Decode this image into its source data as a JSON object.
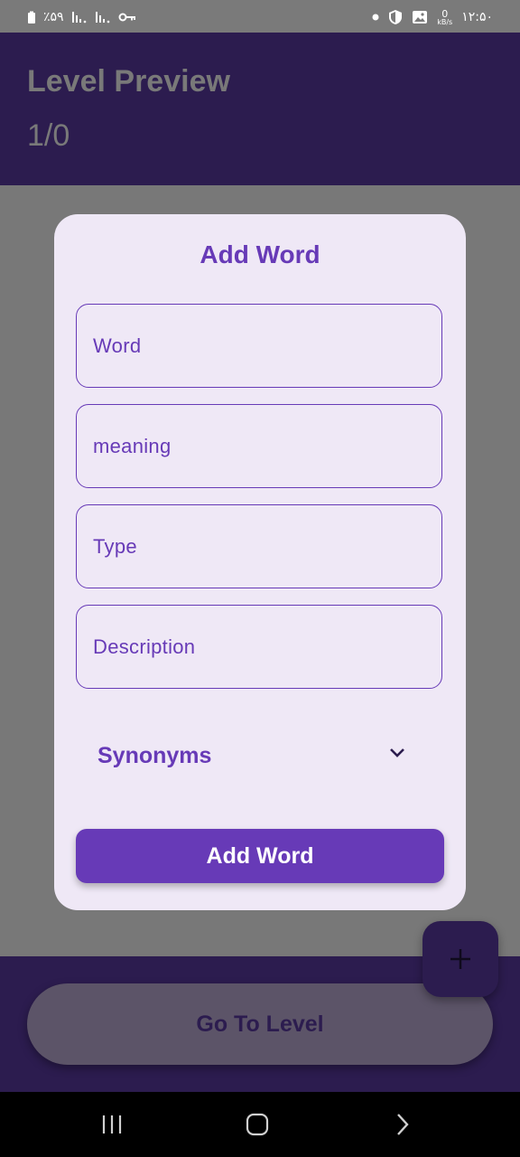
{
  "status_bar": {
    "battery_text": "٪۵۹",
    "time": "۱۲:۵۰",
    "net_speed_value": "0",
    "net_speed_unit": "kB/s",
    "left_icons": [
      "battery-icon",
      "signal-icon",
      "signal-icon",
      "vpn-key-icon"
    ],
    "right_icons": [
      "dot-icon",
      "shield-icon",
      "image-icon"
    ]
  },
  "app_bar": {
    "title": "Level Preview",
    "subtitle": "1/0"
  },
  "dialog": {
    "title": "Add Word",
    "fields": [
      {
        "placeholder": "Word"
      },
      {
        "placeholder": "meaning"
      },
      {
        "placeholder": "Type"
      },
      {
        "placeholder": "Description"
      }
    ],
    "synonyms_label": "Synonyms",
    "submit_label": "Add Word"
  },
  "bottom": {
    "go_button_label": "Go To Level",
    "fab_icon": "plus-icon"
  },
  "nav_bar": {
    "icons": [
      "recents-icon",
      "home-icon",
      "back-icon"
    ]
  },
  "colors": {
    "primary": "#673ab7",
    "dark_purple": "#2c1c4f",
    "dialog_bg": "#efe8f6",
    "scrim": "#787878"
  }
}
